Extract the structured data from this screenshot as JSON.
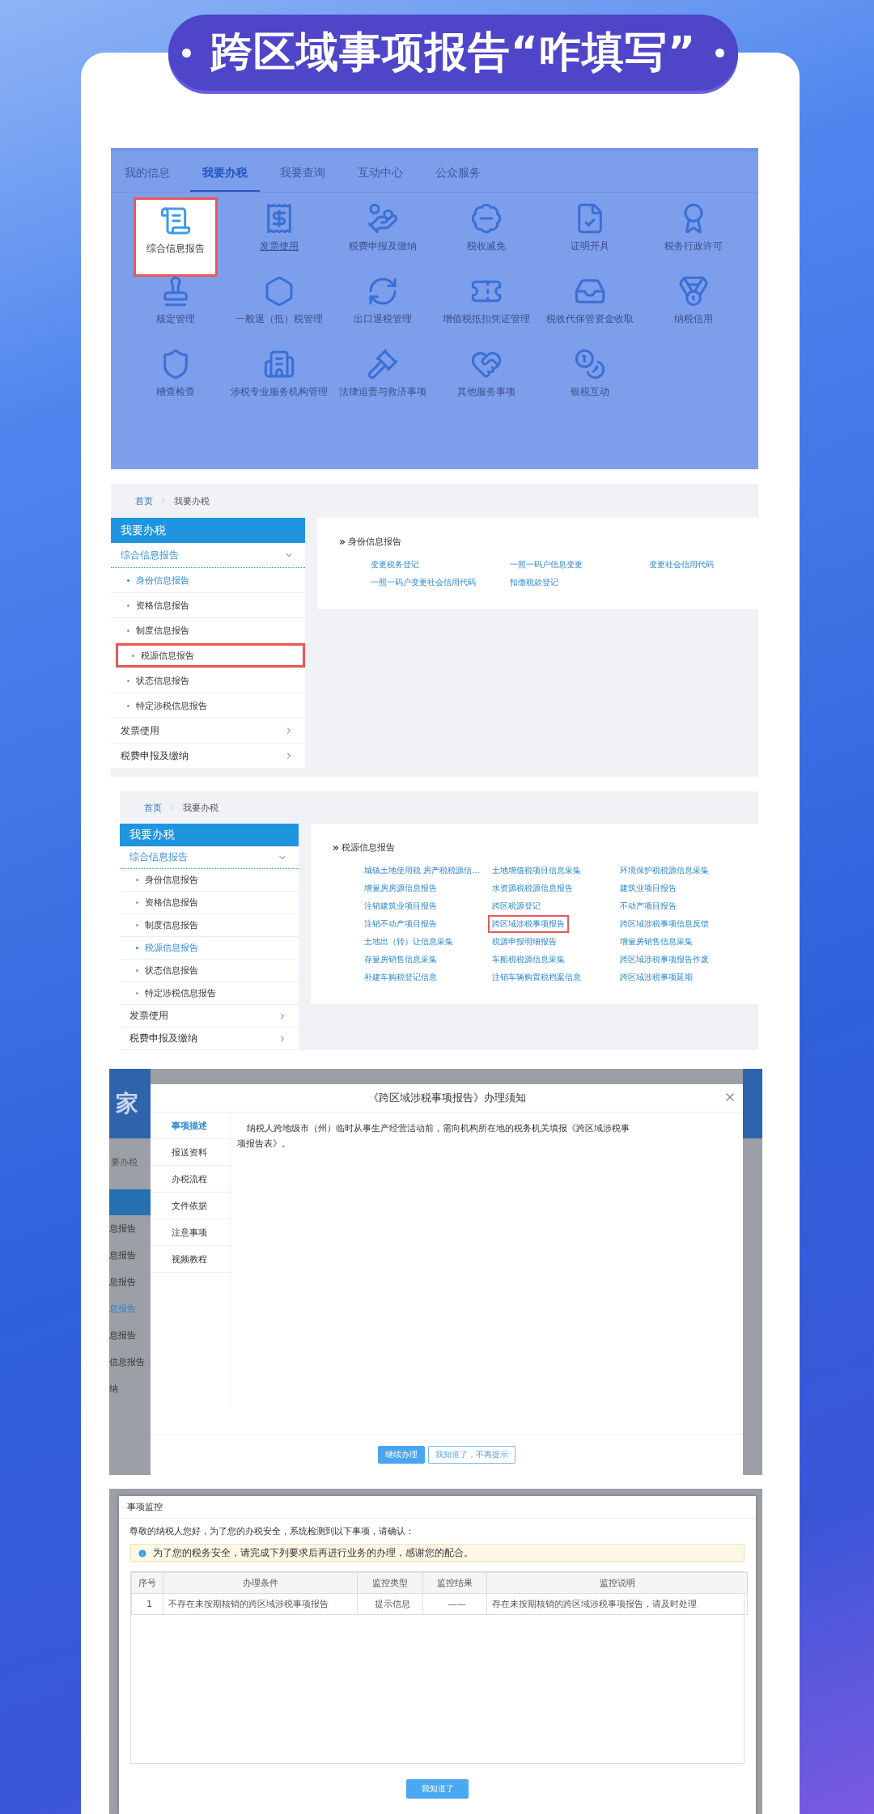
{
  "banner": {
    "title": "跨区域事项报告“咋填写”"
  },
  "portal": {
    "tabs": [
      {
        "label": "我的信息",
        "selected": false
      },
      {
        "label": "我要办税",
        "selected": true
      },
      {
        "label": "我要查询",
        "selected": false
      },
      {
        "label": "互动中心",
        "selected": false
      },
      {
        "label": "公众服务",
        "selected": false
      }
    ],
    "items": [
      {
        "label": "综合信息报告",
        "highlighted": true,
        "hovered": false
      },
      {
        "label": "发票使用",
        "highlighted": false,
        "hovered": true
      },
      {
        "label": "税费申报及缴纳",
        "highlighted": false,
        "hovered": false
      },
      {
        "label": "税收减免",
        "highlighted": false,
        "hovered": false
      },
      {
        "label": "证明开具",
        "highlighted": false,
        "hovered": false
      },
      {
        "label": "税务行政许可",
        "highlighted": false,
        "hovered": false
      },
      {
        "label": "核定管理",
        "highlighted": false,
        "hovered": false
      },
      {
        "label": "一般退（抵）税管理",
        "highlighted": false,
        "hovered": false
      },
      {
        "label": "出口退税管理",
        "highlighted": false,
        "hovered": false
      },
      {
        "label": "增值税抵扣凭证管理",
        "highlighted": false,
        "hovered": false
      },
      {
        "label": "税收代保管资金收取",
        "highlighted": false,
        "hovered": false
      },
      {
        "label": "纳税信用",
        "highlighted": false,
        "hovered": false
      },
      {
        "label": "稽查检查",
        "highlighted": false,
        "hovered": false
      },
      {
        "label": "涉税专业服务机构管理",
        "highlighted": false,
        "hovered": false
      },
      {
        "label": "法律追责与救济事项",
        "highlighted": false,
        "hovered": false
      },
      {
        "label": "其他服务事项",
        "highlighted": false,
        "hovered": false
      },
      {
        "label": "银税互动",
        "highlighted": false,
        "hovered": false
      }
    ]
  },
  "pages": [
    {
      "breadcrumb": [
        {
          "label": "首页",
          "link": true
        },
        {
          "label": "我要办税",
          "link": false
        }
      ],
      "sidebar": {
        "title": "我要办税",
        "group": {
          "label": "综合信息报告",
          "expanded": true,
          "children": [
            {
              "label": "身份信息报告",
              "selected": true,
              "highlighted": false
            },
            {
              "label": "资格信息报告",
              "selected": false,
              "highlighted": false
            },
            {
              "label": "制度信息报告",
              "selected": false,
              "highlighted": false
            },
            {
              "label": "税源信息报告",
              "selected": false,
              "highlighted": true
            },
            {
              "label": "状态信息报告",
              "selected": false,
              "highlighted": false
            },
            {
              "label": "特定涉税信息报告",
              "selected": false,
              "highlighted": false
            }
          ]
        },
        "items": [
          {
            "label": "发票使用",
            "expanded": false
          },
          {
            "label": "税费申报及缴纳",
            "expanded": false
          }
        ]
      },
      "section": "身份信息报告",
      "links": [
        {
          "label": "变更税务登记",
          "highlighted": false
        },
        {
          "label": "一照一码户信息变更",
          "highlighted": false
        },
        {
          "label": "变更社会信用代码",
          "highlighted": false
        },
        {
          "label": "一照一码户变更社会信用代码",
          "highlighted": false
        },
        {
          "label": "扣缴税款登记",
          "highlighted": false
        }
      ]
    },
    {
      "breadcrumb": [
        {
          "label": "首页",
          "link": true
        },
        {
          "label": "我要办税",
          "link": false
        }
      ],
      "sidebar": {
        "title": "我要办税",
        "group": {
          "label": "综合信息报告",
          "expanded": true,
          "children": [
            {
              "label": "身份信息报告",
              "selected": false,
              "highlighted": false
            },
            {
              "label": "资格信息报告",
              "selected": false,
              "highlighted": false
            },
            {
              "label": "制度信息报告",
              "selected": false,
              "highlighted": false
            },
            {
              "label": "税源信息报告",
              "selected": true,
              "highlighted": false
            },
            {
              "label": "状态信息报告",
              "selected": false,
              "highlighted": false
            },
            {
              "label": "特定涉税信息报告",
              "selected": false,
              "highlighted": false
            }
          ]
        },
        "items": [
          {
            "label": "发票使用",
            "expanded": false
          },
          {
            "label": "税费申报及缴纳",
            "expanded": false
          }
        ]
      },
      "section": "税源信息报告",
      "links": [
        {
          "label": "城镇土地使用税 房产税税源信...",
          "highlighted": false
        },
        {
          "label": "土地增值税项目信息采集",
          "highlighted": false
        },
        {
          "label": "环境保护税税源信息采集",
          "highlighted": false
        },
        {
          "label": "增量房房源信息报告",
          "highlighted": false
        },
        {
          "label": "水资源税税源信息报告",
          "highlighted": false
        },
        {
          "label": "建筑业项目报告",
          "highlighted": false
        },
        {
          "label": "注销建筑业项目报告",
          "highlighted": false
        },
        {
          "label": "跨区税源登记",
          "highlighted": false
        },
        {
          "label": "不动产项目报告",
          "highlighted": false
        },
        {
          "label": "注销不动产项目报告",
          "highlighted": false
        },
        {
          "label": "跨区域涉税事项报告",
          "highlighted": true
        },
        {
          "label": "跨区域涉税事项信息反馈",
          "highlighted": false
        },
        {
          "label": "土地出（转）让信息采集",
          "highlighted": false
        },
        {
          "label": "税源申报明细报告",
          "highlighted": false
        },
        {
          "label": "增量房销售信息采集",
          "highlighted": false
        },
        {
          "label": "存量房销售信息采集",
          "highlighted": false
        },
        {
          "label": "车船税税源信息采集",
          "highlighted": false
        },
        {
          "label": "跨区域涉税事项报告作废",
          "highlighted": false
        },
        {
          "label": "补建车购税登记信息",
          "highlighted": false
        },
        {
          "label": "注销车辆购置税档案信息",
          "highlighted": false
        },
        {
          "label": "跨区域涉税事项延期",
          "highlighted": false
        }
      ]
    }
  ],
  "notice_dialog": {
    "backdrop": {
      "site_name": "家",
      "crumb": "要办税",
      "items": [
        {
          "label": "息报告",
          "selected": false
        },
        {
          "label": "息报告",
          "selected": false
        },
        {
          "label": "息报告",
          "selected": false
        },
        {
          "label": "息报告",
          "selected": true
        },
        {
          "label": "息报告",
          "selected": false
        },
        {
          "label": "信息报告",
          "selected": false
        },
        {
          "label": "纳",
          "selected": false
        }
      ]
    },
    "title": "《跨区域涉税事项报告》办理须知",
    "tabs": [
      {
        "label": "事项描述",
        "selected": true
      },
      {
        "label": "报送资料",
        "selected": false
      },
      {
        "label": "办税流程",
        "selected": false
      },
      {
        "label": "文件依据",
        "selected": false
      },
      {
        "label": "注意事项",
        "selected": false
      },
      {
        "label": "视频教程",
        "selected": false
      }
    ],
    "body": "纳税人跨地级市（州）临时从事生产经营活动前，需向机构所在地的税务机关填报《跨区域涉税事项报告表》。",
    "buttons": [
      {
        "label": "继续办理",
        "kind": "primary"
      },
      {
        "label": "我知道了，不再提示",
        "kind": "outline"
      }
    ]
  },
  "monitor_dialog": {
    "title": "事项监控",
    "greeting": "尊敬的纳税人您好，为了您的办税安全，系统检测到以下事项，请确认：",
    "notice": "为了您的税务安全，请完成下列要求后再进行业务的办理，感谢您的配合。",
    "table": {
      "columns": [
        "序号",
        "办理条件",
        "监控类型",
        "监控结果",
        "监控说明"
      ],
      "rows": [
        [
          "1",
          "不存在未按期核销的跨区域涉税事项报告",
          "提示信息",
          "——",
          "存在未按期核销的跨区域涉税事项报告，请及时处理"
        ]
      ]
    },
    "button": "我知道了"
  }
}
